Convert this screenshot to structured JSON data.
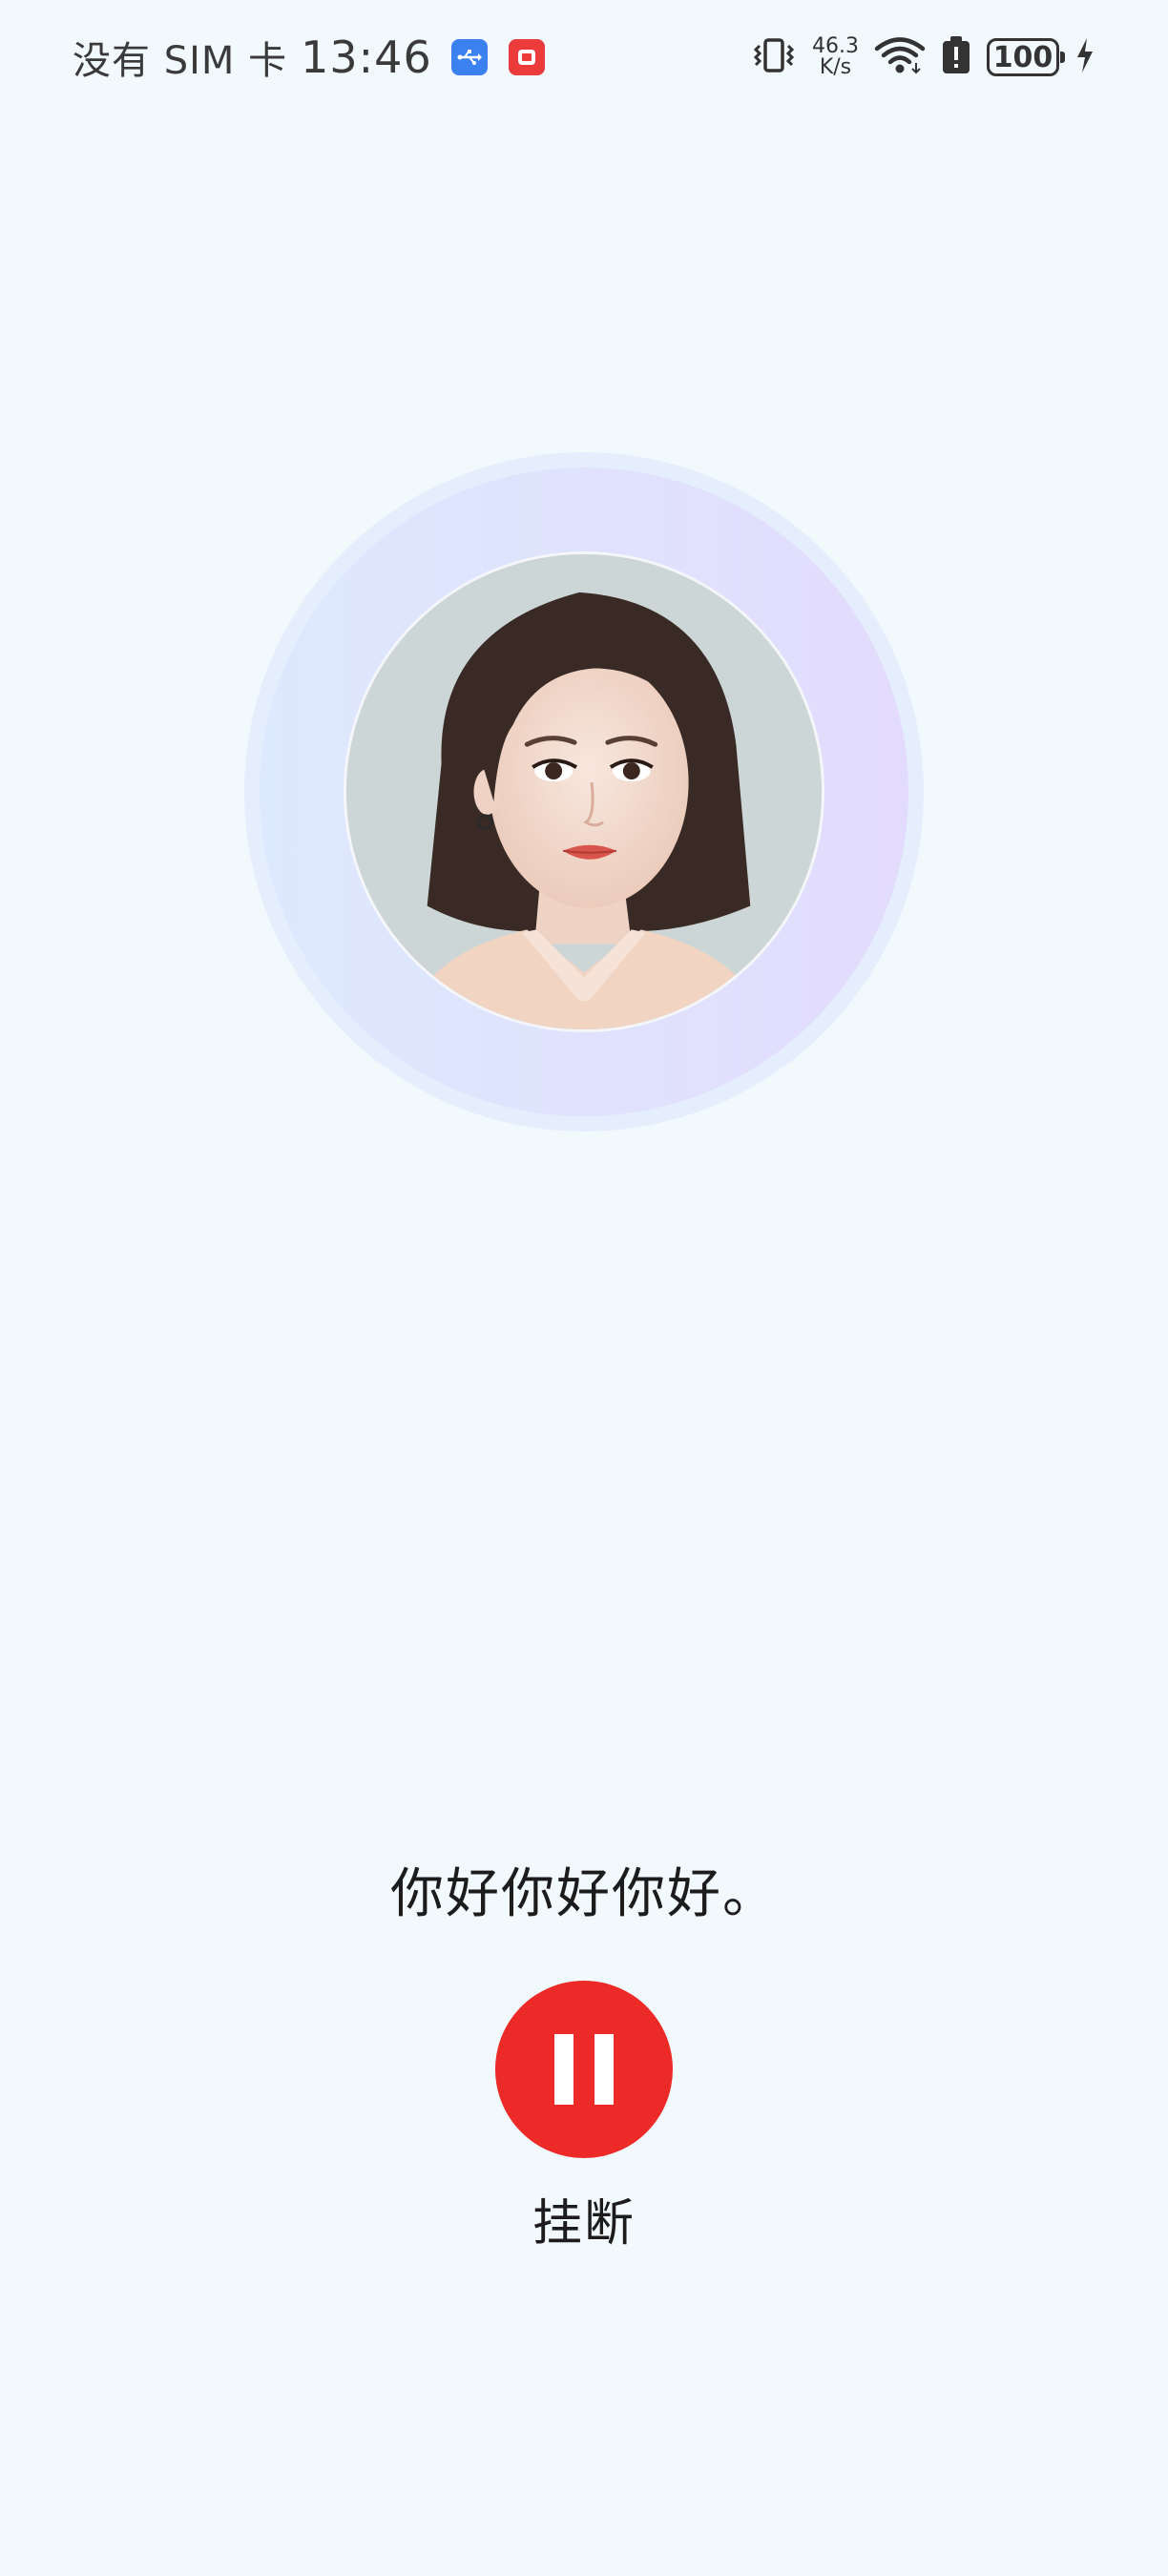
{
  "status_bar": {
    "carrier": "没有 SIM 卡",
    "time": "13:46",
    "net_speed_value": "46.3",
    "net_speed_unit": "K/s",
    "battery": "100",
    "icons": [
      "usb-icon",
      "notification-icon",
      "vibrate-icon",
      "wifi-icon",
      "alert-icon",
      "battery-icon",
      "charging-icon"
    ]
  },
  "call": {
    "transcript": "你好你好你好。",
    "hangup_label": "挂断"
  },
  "colors": {
    "background": "#F1F9FD",
    "hangup": "#EC2A27",
    "ring_start": "#DDE9FE",
    "ring_end": "#E3DBFD"
  }
}
